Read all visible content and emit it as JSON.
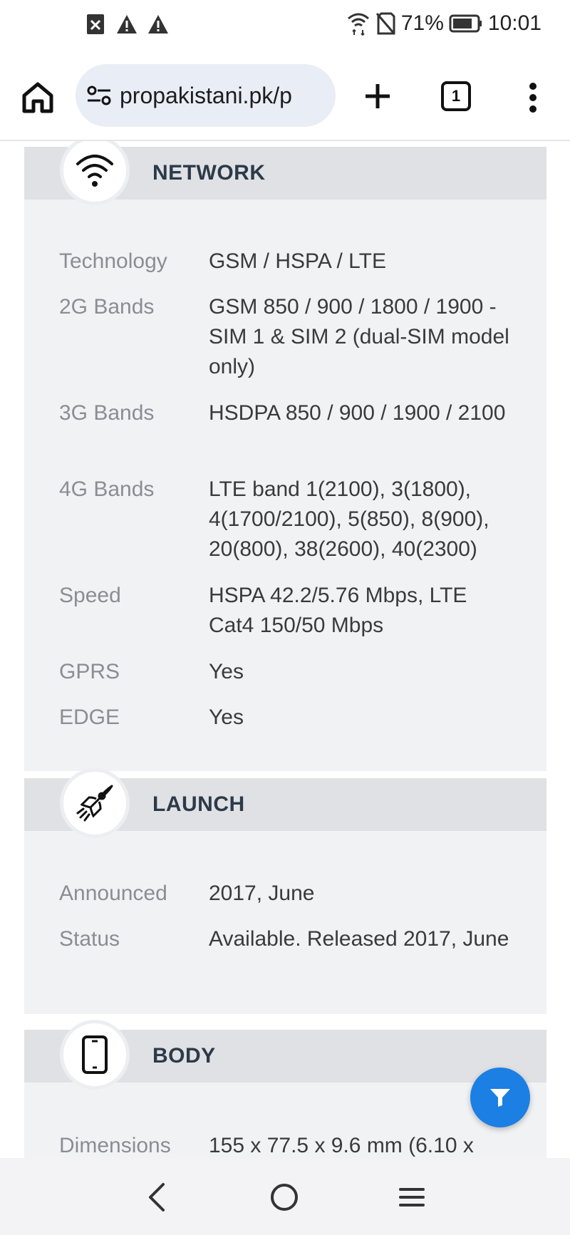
{
  "status_bar": {
    "battery": "71%",
    "time": "10:01"
  },
  "browser": {
    "url": "propakistani.pk/p",
    "tab_count": "1"
  },
  "sections": {
    "network": {
      "title": "NETWORK",
      "rows": [
        {
          "label": "Technology",
          "value": "GSM / HSPA / LTE"
        },
        {
          "label": "2G Bands",
          "value": "GSM 850 / 900 / 1800 / 1900 - SIM 1 & SIM 2 (dual-SIM model only)"
        },
        {
          "label": "3G Bands",
          "value": "HSDPA 850 / 900 / 1900 / 2100"
        },
        {
          "label": "4G Bands",
          "value": "LTE band 1(2100), 3(1800), 4(1700/2100), 5(850), 8(900), 20(800), 38(2600), 40(2300)"
        },
        {
          "label": "Speed",
          "value": "HSPA 42.2/5.76 Mbps, LTE Cat4 150/50 Mbps"
        },
        {
          "label": "GPRS",
          "value": "Yes"
        },
        {
          "label": "EDGE",
          "value": "Yes"
        }
      ]
    },
    "launch": {
      "title": "LAUNCH",
      "rows": [
        {
          "label": "Announced",
          "value": "2017, June"
        },
        {
          "label": "Status",
          "value": "Available. Released 2017, June"
        }
      ]
    },
    "body": {
      "title": "BODY",
      "rows": [
        {
          "label": "Dimensions",
          "value": "155 x 77.5 x 9.6 mm (6.10 x"
        }
      ]
    }
  },
  "icons": {
    "network": "wifi-icon",
    "launch": "rocket-icon",
    "body": "phone-icon",
    "fab": "filter-icon"
  },
  "colors": {
    "accent": "#1b7fe3",
    "section_header_bg": "#e0e1e4",
    "card_bg": "#f1f2f4",
    "label_text": "#8a8d93",
    "title_text": "#2c3a4a"
  }
}
